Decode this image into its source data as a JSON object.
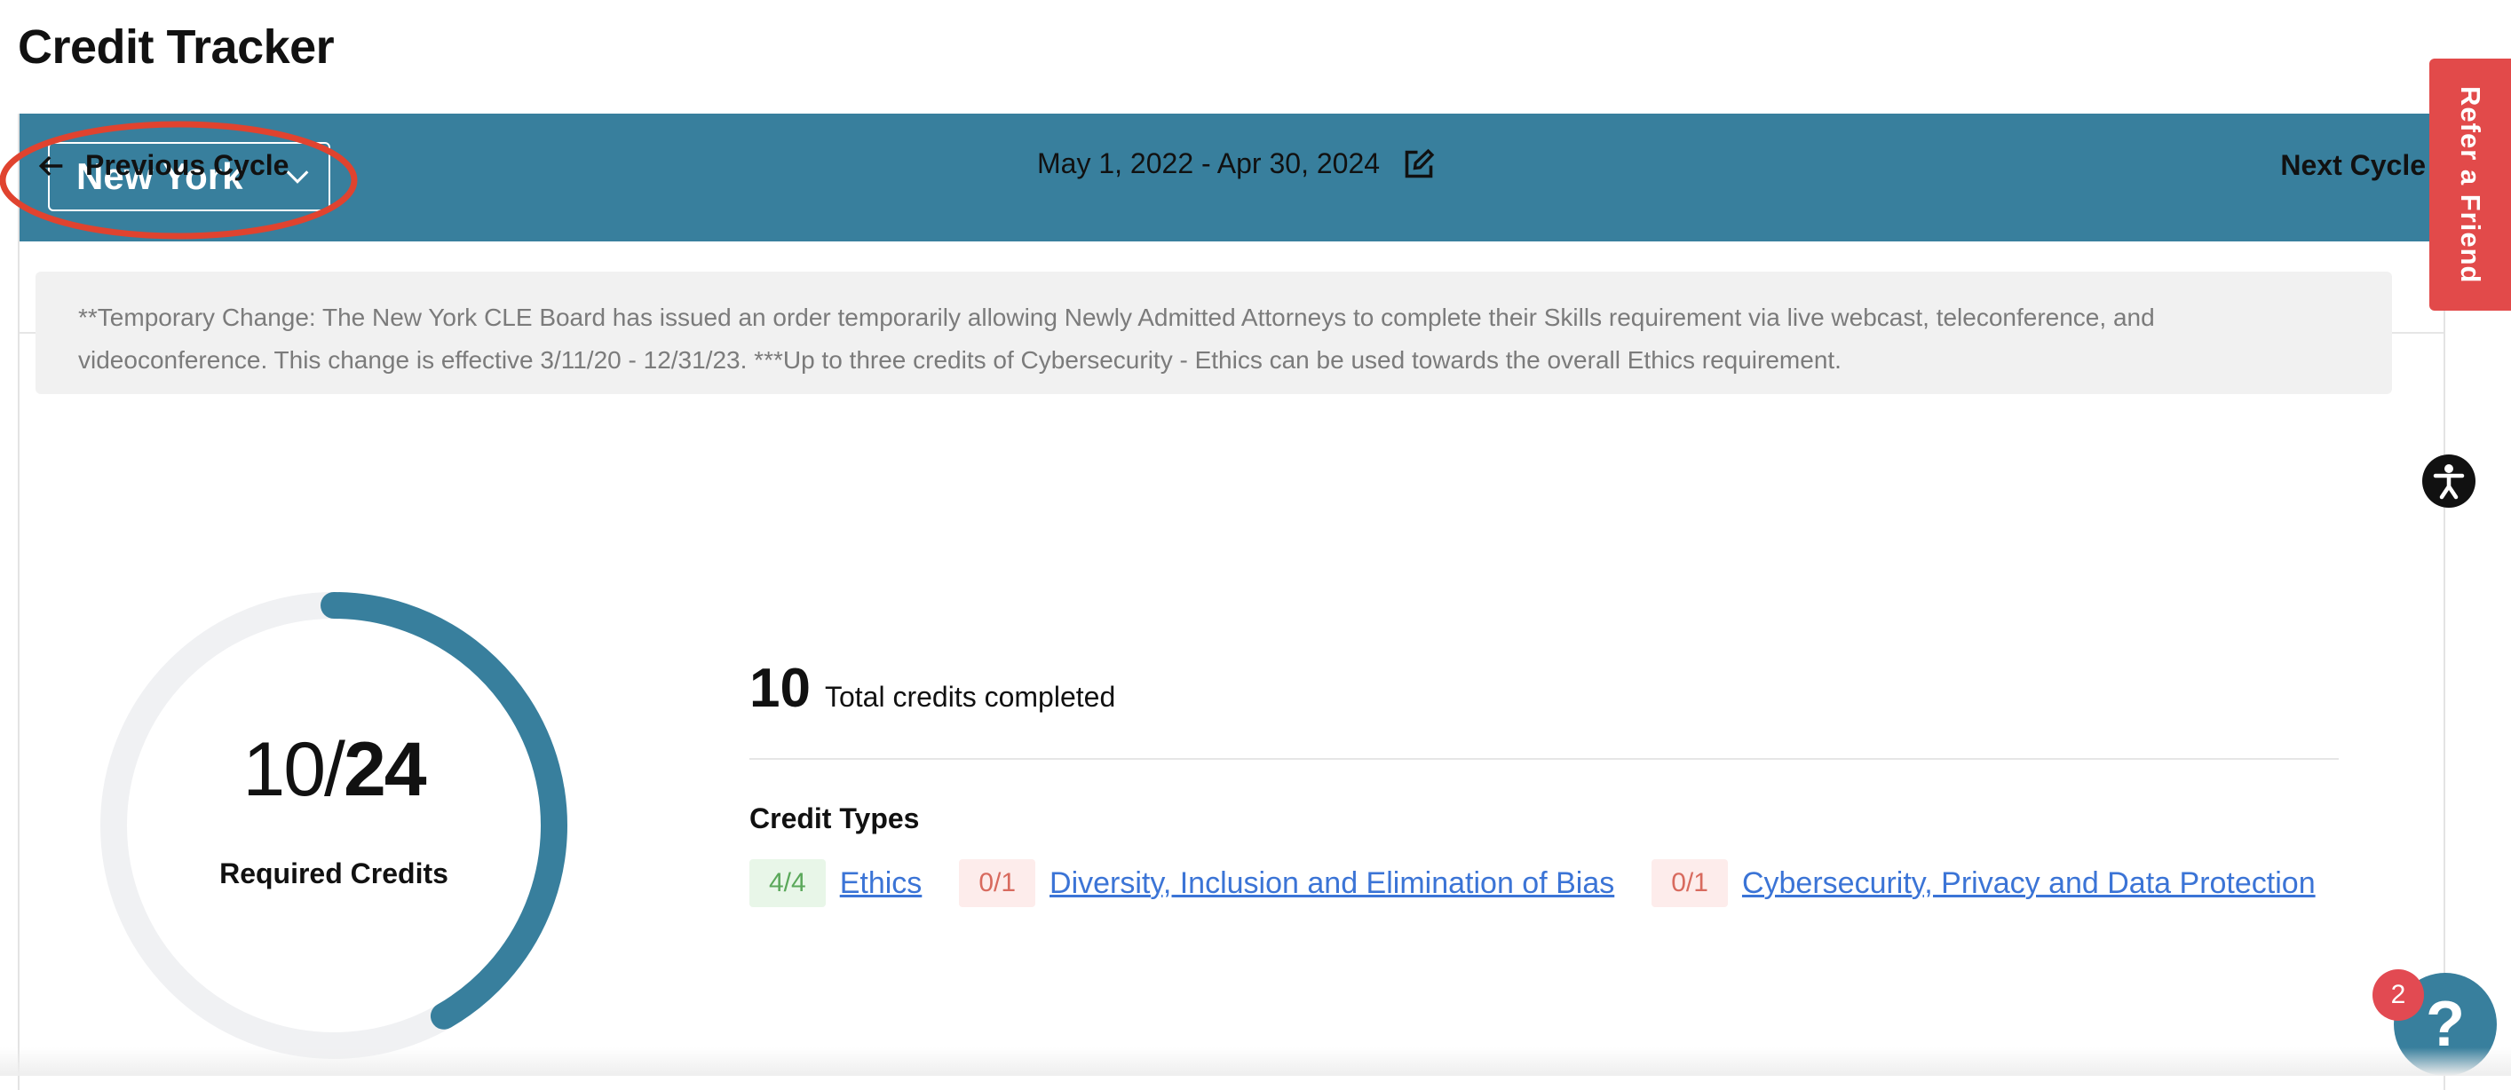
{
  "page": {
    "title": "Credit Tracker"
  },
  "jurisdiction": {
    "selected": "New York"
  },
  "cycle": {
    "previous_label": "Previous Cycle",
    "next_label": "Next Cycle",
    "dates": "May 1, 2022 - Apr 30, 2024"
  },
  "notice": {
    "text": "**Temporary Change: The New York CLE Board has issued an order temporarily allowing Newly Admitted Attorneys to complete their Skills requirement via live webcast, teleconference, and videoconference. This change is effective 3/11/20 - 12/31/23. ***Up to three credits of Cybersecurity - Ethics can be used towards the overall Ethics requirement."
  },
  "progress": {
    "completed": "10",
    "required": "24",
    "separator": "/",
    "label": "Required Credits",
    "fraction": 0.4167
  },
  "total": {
    "value": "10",
    "label": "Total credits completed"
  },
  "credit_types": {
    "title": "Credit Types",
    "items": [
      {
        "badge": "4/4",
        "name": "Ethics",
        "status": "complete"
      },
      {
        "badge": "0/1",
        "name": "Diversity, Inclusion and Elimination of Bias",
        "status": "incomplete"
      },
      {
        "badge": "0/1",
        "name": "Cybersecurity, Privacy and Data Protection",
        "status": "incomplete"
      }
    ]
  },
  "side_tab": {
    "label": "Refer a Friend"
  },
  "help": {
    "badge_count": "2",
    "icon_glyph": "?"
  },
  "colors": {
    "header": "#387f9d",
    "ring": "#387f9d",
    "ring_track": "#f0f1f3",
    "refer_tab": "#e24a4a",
    "annotation": "#e0432f"
  }
}
